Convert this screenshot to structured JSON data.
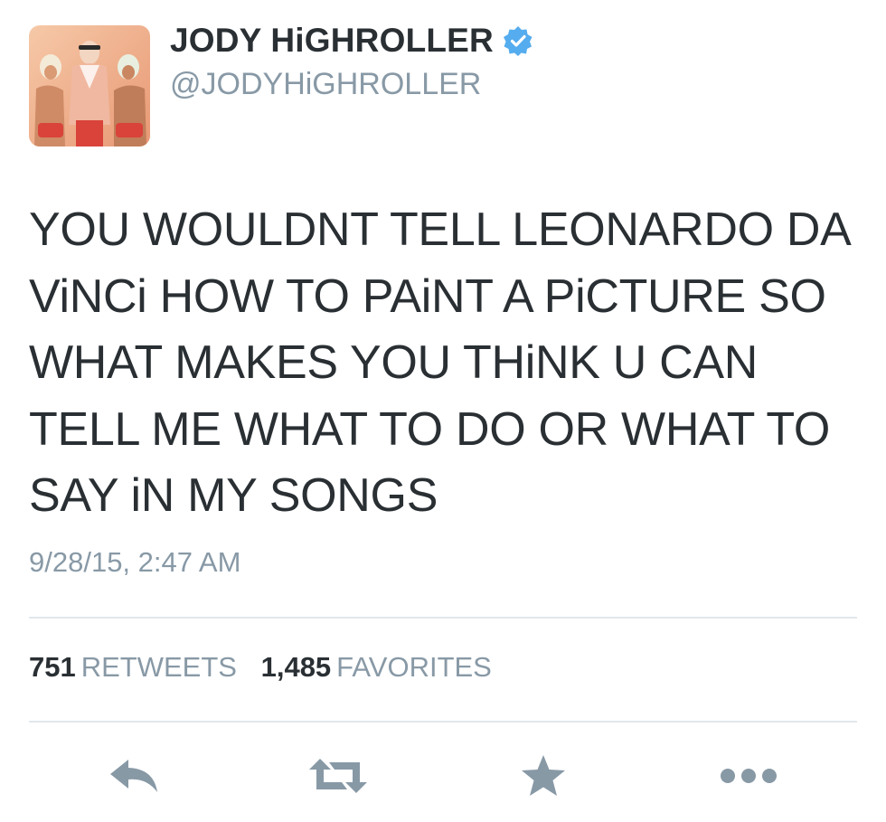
{
  "user": {
    "display_name": "JODY HiGHROLLER",
    "handle": "@JODYHiGHROLLER",
    "verified": true,
    "avatar_icon": "profile-photo"
  },
  "tweet": {
    "text": "YOU WOULDNT TELL LEONARDO DA ViNCi HOW TO PAiNT A PiCTURE SO WHAT MAKES YOU THiNK U CAN TELL ME WHAT TO DO OR WHAT TO SAY iN MY SONGS",
    "timestamp": "9/28/15, 2:47 AM"
  },
  "stats": {
    "retweets_count": "751",
    "retweets_label": "RETWEETS",
    "favorites_count": "1,485",
    "favorites_label": "FAVORITES"
  },
  "actions": [
    {
      "icon": "reply-icon"
    },
    {
      "icon": "retweet-icon"
    },
    {
      "icon": "star-icon"
    },
    {
      "icon": "more-icon"
    }
  ],
  "colors": {
    "text": "#292f33",
    "muted": "#8899a6",
    "verified": "#55acee",
    "divider": "#e1e8ed",
    "action_icon": "#8899a6"
  }
}
